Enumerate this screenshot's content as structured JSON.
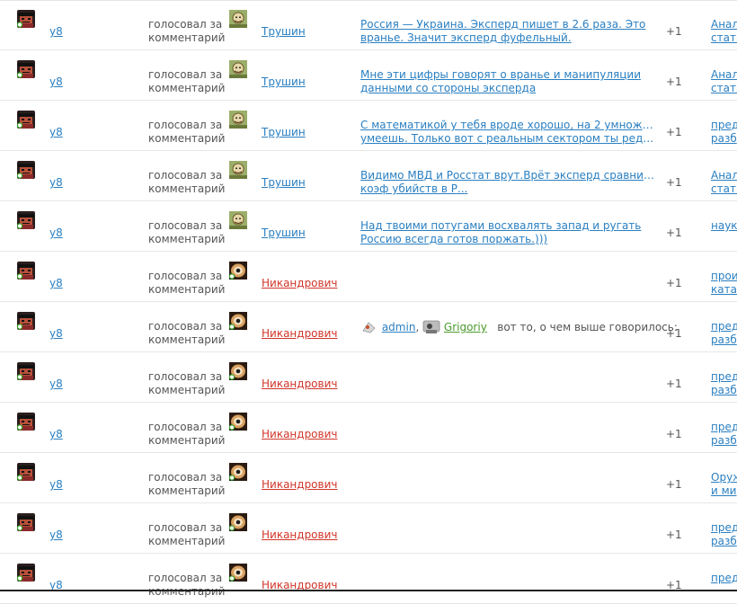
{
  "action_text": "голосовал за комментарий",
  "rows": [
    {
      "voter": "y8",
      "target": "Трушин",
      "target_kind": "tru",
      "comment": [
        "Россия — Украина.  Эксперд пишет в 2.6 раза. Это",
        "вранье. Значит эксперд фуфельный."
      ],
      "score": "+1",
      "article": [
        "Анал",
        "стать"
      ]
    },
    {
      "voter": "y8",
      "target": "Трушин",
      "target_kind": "tru",
      "comment": [
        "Мне эти цифры говорят о вранье и манипуляции",
        "данными со стороны эксперда"
      ],
      "score": "+1",
      "article": [
        "Анал",
        "стать"
      ]
    },
    {
      "voter": "y8",
      "target": "Трушин",
      "target_kind": "tru",
      "comment": [
        "С математикой у тебя вроде хорошо, на 2 умножать",
        "умеешь. Только вот с реальным сектором ты редко ..."
      ],
      "score": "+1",
      "article": [
        "пред",
        "разб"
      ]
    },
    {
      "voter": "y8",
      "target": "Трушин",
      "target_kind": "tru",
      "comment": [
        "Видимо МВД и Росстат врут.Врёт эксперд сравнивая",
        "коэф убийств в Р..."
      ],
      "score": "+1",
      "article": [
        "Анал",
        "стать"
      ]
    },
    {
      "voter": "y8",
      "target": "Трушин",
      "target_kind": "tru",
      "comment": [
        "Над твоими потугами восхвалять запад и ругать",
        "Россию всегда готов поржать.)))"
      ],
      "score": "+1",
      "article": [
        "наук",
        ""
      ]
    },
    {
      "voter": "y8",
      "target": "Никандрович",
      "target_kind": "nik",
      "comment": [],
      "score": "+1",
      "article": [
        "прои",
        "катас"
      ]
    },
    {
      "voter": "y8",
      "target": "Никандрович",
      "target_kind": "nik",
      "comment": [],
      "mentions": {
        "a": "admin",
        "b": "Grigoriy",
        "text": "вот то, о чем  выше говорилось:"
      },
      "score": "+1",
      "article": [
        "пред",
        "разб"
      ]
    },
    {
      "voter": "y8",
      "target": "Никандрович",
      "target_kind": "nik",
      "comment": [],
      "score": "+1",
      "article": [
        "пред",
        "разб"
      ]
    },
    {
      "voter": "y8",
      "target": "Никандрович",
      "target_kind": "nik",
      "comment": [],
      "score": "+1",
      "article": [
        "пред",
        "разб"
      ]
    },
    {
      "voter": "y8",
      "target": "Никандрович",
      "target_kind": "nik",
      "comment": [],
      "score": "+1",
      "article": [
        "Оруж",
        "и мир"
      ]
    },
    {
      "voter": "y8",
      "target": "Никандрович",
      "target_kind": "nik",
      "comment": [],
      "score": "+1",
      "article": [
        "пред",
        "разб"
      ]
    },
    {
      "voter": "y8",
      "target": "Никандрович",
      "target_kind": "nik",
      "comment": [],
      "score": "+1",
      "article": [
        "пред",
        ""
      ]
    }
  ]
}
